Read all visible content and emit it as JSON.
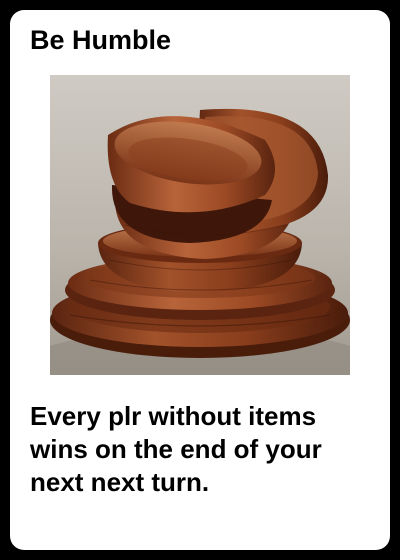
{
  "card": {
    "title": "Be Humble",
    "rules_text": "Every plr without items wins on the end of your next next turn.",
    "art": {
      "icon": "stacked-wooden-bowls-image"
    }
  },
  "colors": {
    "frame": "#000000",
    "card_background": "#ffffff",
    "text": "#000000"
  }
}
